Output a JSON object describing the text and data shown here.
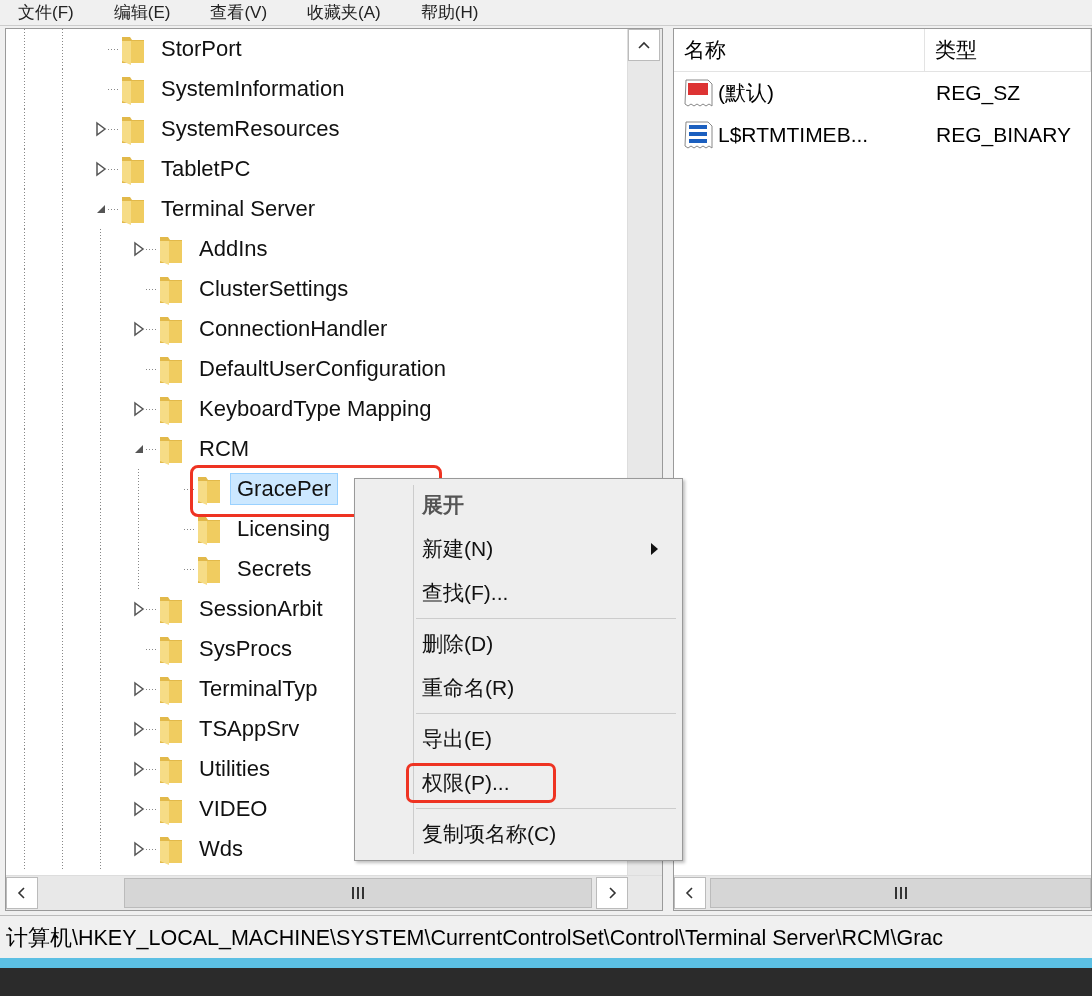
{
  "menu_bar": [
    "文件(F)",
    "编辑(E)",
    "查看(V)",
    "收藏夹(A)",
    "帮助(H)"
  ],
  "tree": [
    {
      "label": "StorPort",
      "selected": false,
      "highlighted": false
    },
    {
      "label": "SystemInformation",
      "selected": false,
      "highlighted": false
    },
    {
      "label": "SystemResources",
      "expanded": false,
      "selected": false,
      "highlighted": false
    },
    {
      "label": "TabletPC",
      "expanded": false,
      "selected": false,
      "highlighted": false
    },
    {
      "label": "Terminal Server",
      "expanded": true,
      "selected": false,
      "highlighted": false,
      "children": [
        {
          "label": "AddIns",
          "expanded": false,
          "selected": false,
          "highlighted": false
        },
        {
          "label": "ClusterSettings",
          "selected": false,
          "highlighted": false
        },
        {
          "label": "ConnectionHandler",
          "expanded": false,
          "selected": false,
          "highlighted": false
        },
        {
          "label": "DefaultUserConfiguration",
          "selected": false,
          "highlighted": false
        },
        {
          "label": "KeyboardType Mapping",
          "expanded": false,
          "selected": false,
          "highlighted": false
        },
        {
          "label": "RCM",
          "expanded": true,
          "selected": false,
          "highlighted": false,
          "children": [
            {
              "label": "GracePer",
              "selected": true,
              "highlighted": true
            },
            {
              "label": "Licensing",
              "selected": false,
              "highlighted": false
            },
            {
              "label": "Secrets",
              "selected": false,
              "highlighted": false
            }
          ]
        },
        {
          "label": "SessionArbit",
          "expanded": false,
          "selected": false,
          "highlighted": false
        },
        {
          "label": "SysProcs",
          "selected": false,
          "highlighted": false
        },
        {
          "label": "TerminalTyp",
          "expanded": false,
          "selected": false,
          "highlighted": false
        },
        {
          "label": "TSAppSrv",
          "expanded": false,
          "selected": false,
          "highlighted": false
        },
        {
          "label": "Utilities",
          "expanded": false,
          "selected": false,
          "highlighted": false
        },
        {
          "label": "VIDEO",
          "expanded": false,
          "selected": false,
          "highlighted": false
        },
        {
          "label": "Wds",
          "expanded": false,
          "selected": false,
          "highlighted": false
        }
      ]
    }
  ],
  "values": {
    "columns": [
      "名称",
      "类型"
    ],
    "rows": [
      {
        "kind": "string",
        "name": "(默认)",
        "type": "REG_SZ"
      },
      {
        "kind": "binary",
        "name": "L$RTMTIMEB...",
        "type": "REG_BINARY"
      }
    ]
  },
  "context_menu": [
    {
      "kind": "item",
      "label": "展开",
      "bold": true,
      "submenu": false,
      "highlighted": false
    },
    {
      "kind": "item",
      "label": "新建(N)",
      "bold": false,
      "submenu": true,
      "highlighted": false
    },
    {
      "kind": "item",
      "label": "查找(F)...",
      "bold": false,
      "submenu": false,
      "highlighted": false
    },
    {
      "kind": "separator"
    },
    {
      "kind": "item",
      "label": "删除(D)",
      "bold": false,
      "submenu": false,
      "highlighted": false
    },
    {
      "kind": "item",
      "label": "重命名(R)",
      "bold": false,
      "submenu": false,
      "highlighted": false
    },
    {
      "kind": "separator"
    },
    {
      "kind": "item",
      "label": "导出(E)",
      "bold": false,
      "submenu": false,
      "highlighted": false
    },
    {
      "kind": "item",
      "label": "权限(P)...",
      "bold": false,
      "submenu": false,
      "highlighted": true
    },
    {
      "kind": "separator"
    },
    {
      "kind": "item",
      "label": "复制项名称(C)",
      "bold": false,
      "submenu": false,
      "highlighted": false
    }
  ],
  "status_bar": "计算机\\HKEY_LOCAL_MACHINE\\SYSTEM\\CurrentControlSet\\Control\\Terminal Server\\RCM\\Grac"
}
